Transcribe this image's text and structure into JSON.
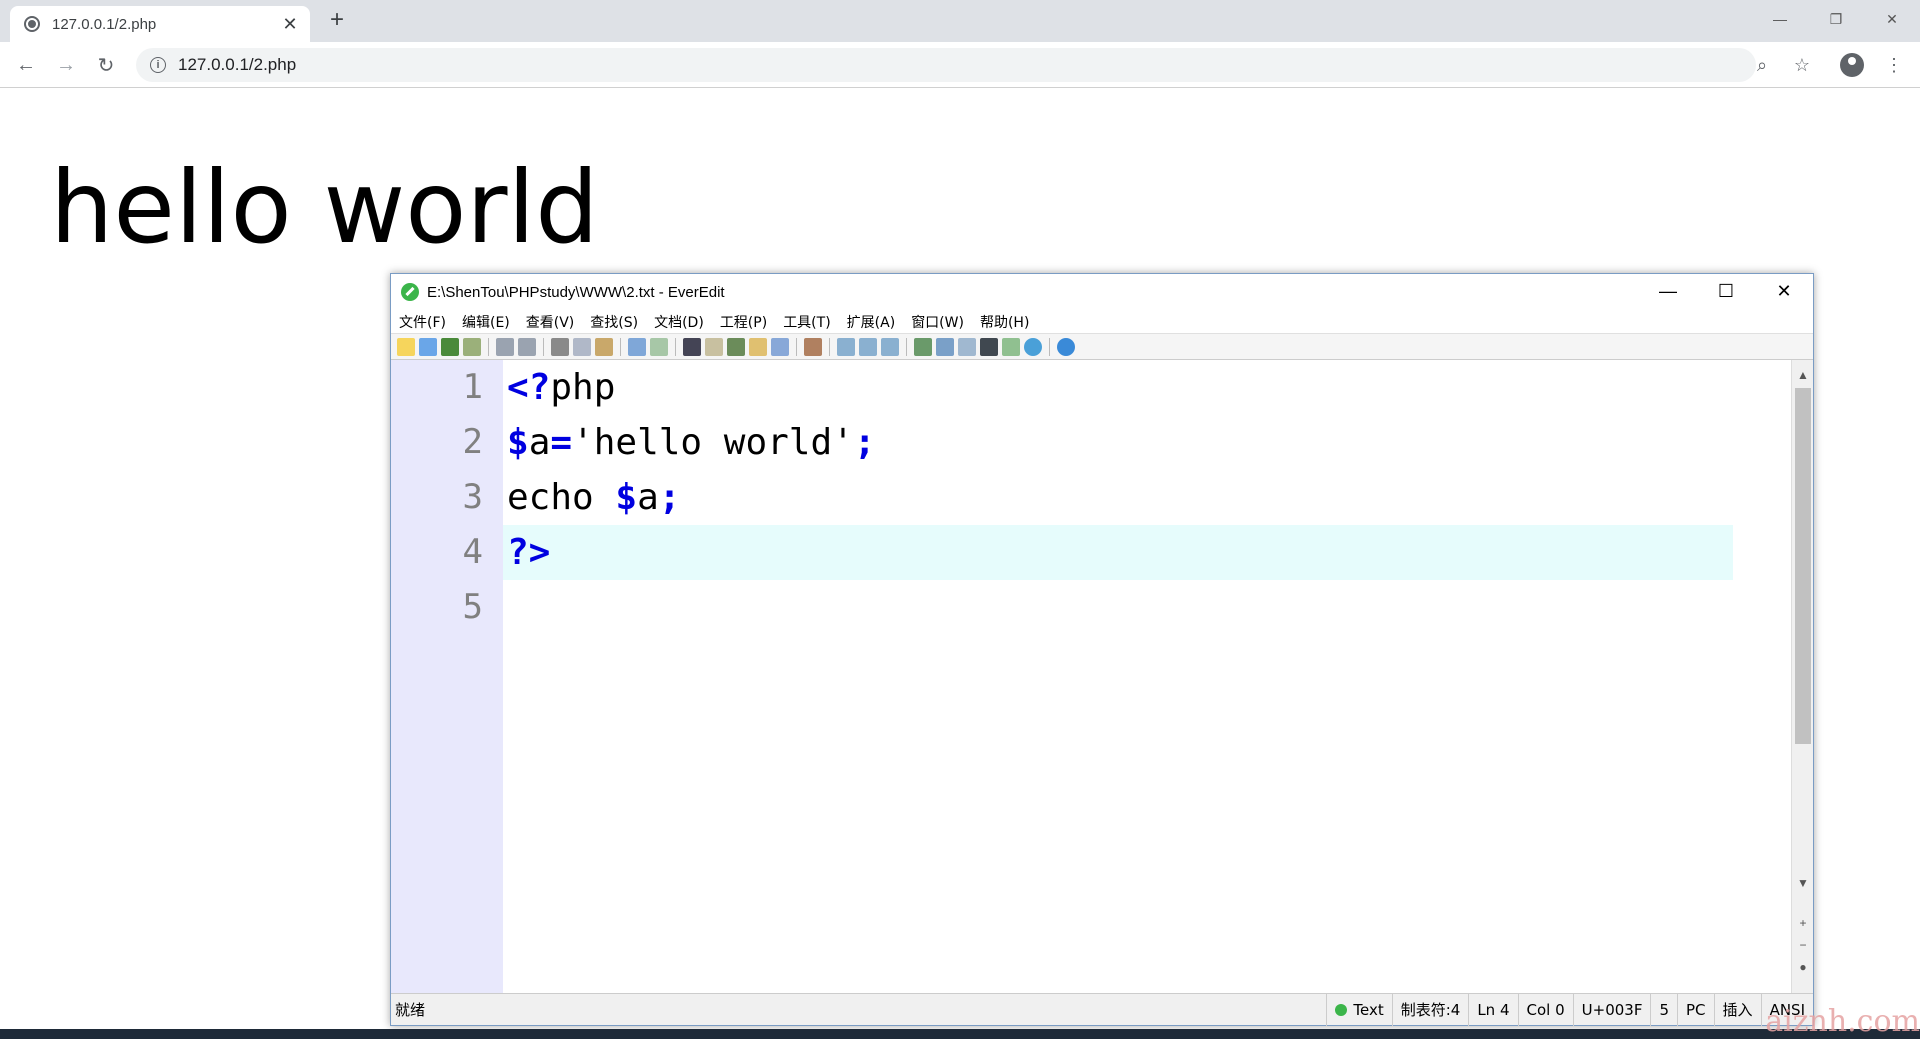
{
  "browser": {
    "tab_title": "127.0.0.1/2.php",
    "url": "127.0.0.1/2.php",
    "icons": [
      "close-icon",
      "plus-icon",
      "back-icon",
      "forward-icon",
      "reload-icon",
      "zoom-icon",
      "star-icon",
      "profile-icon",
      "menu-icon"
    ]
  },
  "page": {
    "text": "hello world"
  },
  "editor": {
    "title": "E:\\ShenTou\\PHPstudy\\WWW\\2.txt - EverEdit",
    "menu": [
      "文件(F)",
      "编辑(E)",
      "查看(V)",
      "查找(S)",
      "文档(D)",
      "工程(P)",
      "工具(T)",
      "扩展(A)",
      "窗口(W)",
      "帮助(H)"
    ],
    "line_numbers": [
      "1",
      "2",
      "3",
      "4",
      "5"
    ],
    "code": {
      "l1_kw": "<?",
      "l1_rest": "php",
      "l2_kw1": "$",
      "l2_a": "a",
      "l2_eq": "=",
      "l2_str": "'hello world'",
      "l2_semi": ";",
      "l3_echo": "echo ",
      "l3_kw": "$",
      "l3_a": "a",
      "l3_semi": ";",
      "l4_kw": "?>"
    },
    "status": {
      "ready": "就绪",
      "mode": "Text",
      "tab": "制表符:4",
      "ln": "Ln 4",
      "col": "Col 0",
      "char": "U+003F",
      "num": "5",
      "eol": "PC",
      "insert": "插入",
      "encoding": "ANSI"
    }
  },
  "watermark": "aiznh.com"
}
